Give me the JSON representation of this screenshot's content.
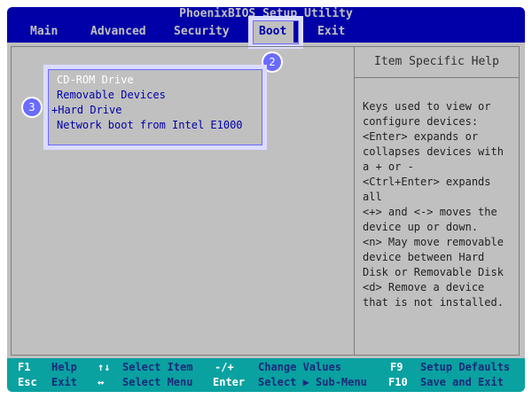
{
  "title": "PhoenixBIOS Setup Utility",
  "menu": [
    "Main",
    "Advanced",
    "Security",
    "Boot",
    "Exit"
  ],
  "active_menu": "Boot",
  "boot_items": [
    "CD-ROM Drive",
    "Removable Devices",
    "Hard Drive",
    "Network boot from Intel E1000"
  ],
  "selected_boot_item": "Hard Drive",
  "selected_marker": "+",
  "badges": {
    "boot_tab": "2",
    "boot_list": "3"
  },
  "help": {
    "title": "Item Specific Help",
    "lines": [
      "Keys used to view or",
      "configure devices:",
      "<Enter> expands or",
      "collapses devices with",
      "a + or -",
      "<Ctrl+Enter> expands",
      "all",
      "<+> and <-> moves the",
      "device up or down.",
      "<n> May move removable",
      "device between Hard",
      "Disk or Removable Disk",
      "<d> Remove a device",
      "that is not installed."
    ]
  },
  "footer": [
    {
      "key": "F1",
      "desc": "Help"
    },
    {
      "key": "Esc",
      "desc": "Exit"
    },
    {
      "key": "↑↓",
      "desc": "Select Item"
    },
    {
      "key": "↔",
      "desc": "Select Menu"
    },
    {
      "key": "-/+",
      "desc": "Change Values"
    },
    {
      "key": "Enter",
      "desc": "Select ▶ Sub-Menu"
    },
    {
      "key": "F9",
      "desc": "Setup Defaults"
    },
    {
      "key": "F10",
      "desc": "Save and Exit"
    }
  ],
  "colors": {
    "bios_blue": "#0000a8",
    "bios_gray": "#c0c0c0",
    "footer_cyan": "#0aa1a1",
    "annotation_purple": "#6b6bff"
  }
}
